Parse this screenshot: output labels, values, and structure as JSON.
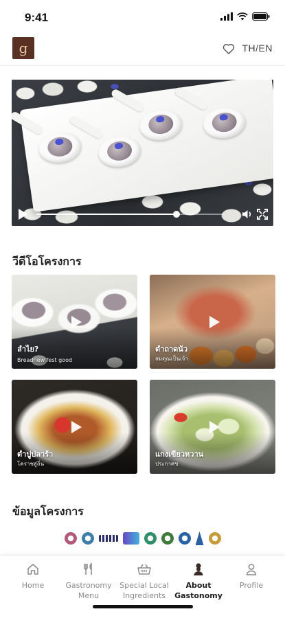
{
  "status_bar": {
    "time": "9:41"
  },
  "header": {
    "lang_toggle": "TH/EN",
    "logo_text": "g"
  },
  "player": {
    "progress": 0.75
  },
  "videos_section": {
    "title": "วีดีโอโครงการ",
    "items": [
      {
        "title": "ลำไย?",
        "subtitle": "Breadnew fest good"
      },
      {
        "title": "ตำถาดนัว",
        "subtitle": "สมตุณเป็นเจ้า"
      },
      {
        "title": "ตำปูปลาร้า",
        "subtitle": "โคราชสู่ถิ่น"
      },
      {
        "title": "แกงเขียวหวาน",
        "subtitle": "ประกาศข"
      }
    ]
  },
  "info_section": {
    "title": "ข้อมูลโครงการ"
  },
  "partner_logos": [
    {
      "name": "partner-seal-1",
      "color": "#b35a7a"
    },
    {
      "name": "partner-seal-2",
      "color": "#3d7fa8"
    },
    {
      "name": "partner-wordmark",
      "color": "#2b2b6b"
    },
    {
      "name": "partner-m-logo",
      "color": "#6a45c8"
    },
    {
      "name": "partner-seal-3",
      "color": "#2f8f6a"
    },
    {
      "name": "partner-seal-4",
      "color": "#3f7a3a"
    },
    {
      "name": "partner-seal-5",
      "color": "#2a62a8"
    },
    {
      "name": "partner-temple",
      "color": "#2c5fa3"
    },
    {
      "name": "partner-crest",
      "color": "#c79a3a"
    }
  ],
  "bottom_nav": [
    {
      "label": "Home",
      "icon": "home-icon",
      "active": false
    },
    {
      "label": "Gastronomy Menu",
      "icon": "cutlery-icon",
      "active": false
    },
    {
      "label": "Special Local Ingredients",
      "icon": "basket-icon",
      "active": false
    },
    {
      "label": "About Gastonomy",
      "icon": "chef-icon",
      "active": true
    },
    {
      "label": "Profile",
      "icon": "person-icon",
      "active": false
    }
  ]
}
